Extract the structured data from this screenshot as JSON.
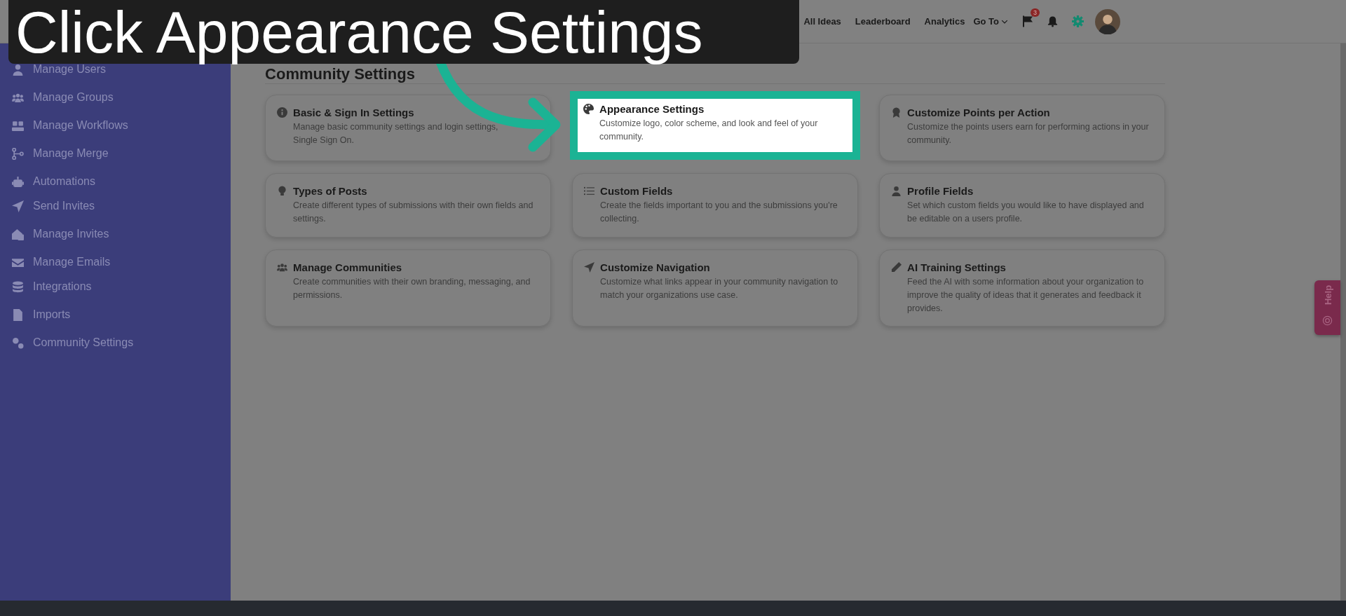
{
  "banner": {
    "text": "Click Appearance Settings"
  },
  "nav": {
    "links": [
      {
        "label": "All Ideas"
      },
      {
        "label": "Leaderboard"
      },
      {
        "label": "Analytics"
      }
    ],
    "goto": "Go To",
    "flag_badge": "3"
  },
  "sidebar": {
    "sections": [
      {
        "items": [
          "Manage Users",
          "Manage Groups",
          "Manage Workflows",
          "Manage Merge",
          "Automations"
        ]
      },
      {
        "items": [
          "Send Invites",
          "Manage Invites",
          "Manage Emails"
        ]
      },
      {
        "items": [
          "Integrations",
          "Imports",
          "Community Settings"
        ]
      }
    ]
  },
  "page_title": "Community Settings",
  "cards": [
    {
      "title": "Basic & Sign In Settings",
      "description": "Manage basic community settings and login settings,",
      "description_2": "Single Sign On.",
      "selected": false
    },
    {
      "title": "Appearance Settings",
      "description": "Customize logo, color scheme, and look and feel of your community.",
      "selected": true
    },
    {
      "title": "Customize Points per Action",
      "description": "Customize the points users earn for performing actions in your community.",
      "selected": false
    },
    {
      "title": "Types of Posts",
      "description": "Create different types of submissions with their own fields and settings.",
      "selected": false
    },
    {
      "title": "Custom Fields",
      "description": "Create the fields important to you and the submissions you're collecting.",
      "selected": false
    },
    {
      "title": "Profile Fields",
      "description": "Set which custom fields you would like to have displayed and be editable on a users profile.",
      "selected": false
    },
    {
      "title": "Manage Communities",
      "description": "Create communities with their own branding, messaging, and permissions.",
      "selected": false
    },
    {
      "title": "Customize Navigation",
      "description": "Customize what links appear in your community navigation to match your organizations use case.",
      "selected": false
    },
    {
      "title": "AI Training Settings",
      "description": "Feed the AI with some information about your organization to improve the quality of ideas that it generates and feedback it provides.",
      "selected": false
    }
  ],
  "help": "Help"
}
